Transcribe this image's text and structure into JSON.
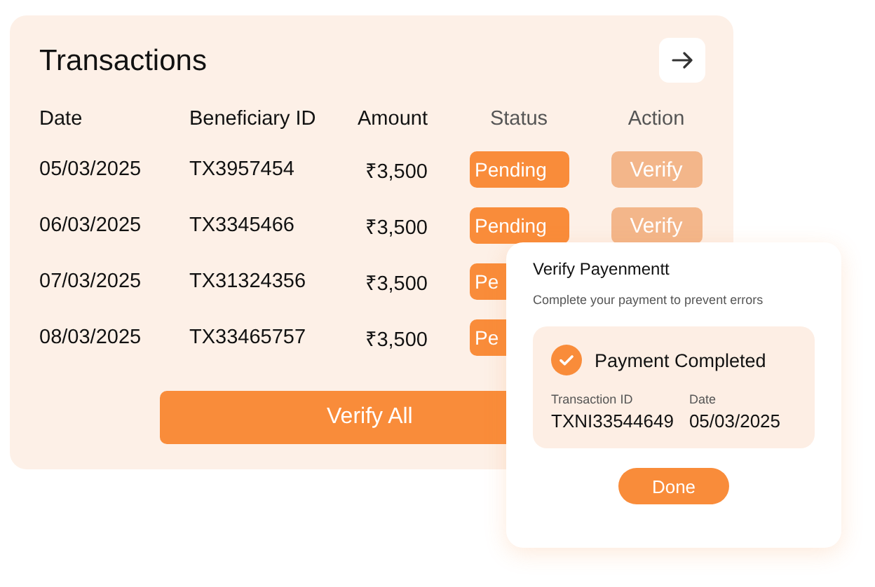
{
  "transactions": {
    "title": "Transactions",
    "columns": [
      "Date",
      "Beneficiary ID",
      "Amount",
      "Status",
      "Action"
    ],
    "rows": [
      {
        "date": "05/03/2025",
        "beneficiary_id": "TX3957454",
        "amount": "₹3,500",
        "status": "Pending",
        "action": "Verify"
      },
      {
        "date": "06/03/2025",
        "beneficiary_id": "TX3345466",
        "amount": "₹3,500",
        "status": "Pending",
        "action": "Verify"
      },
      {
        "date": "07/03/2025",
        "beneficiary_id": "TX31324356",
        "amount": "₹3,500",
        "status": "Pe"
      },
      {
        "date": "08/03/2025",
        "beneficiary_id": "TX33465757",
        "amount": "₹3,500",
        "status": "Pe"
      }
    ],
    "verify_all_button": "Verify All"
  },
  "dialog": {
    "title": "Verify Payenmentt",
    "subtitle": "Complete your payment to prevent errors",
    "result": {
      "title": "Payment Completed",
      "fields": [
        {
          "label": "Transaction ID",
          "value": "TXNI33544649"
        },
        {
          "label": "Date",
          "value": "05/03/2025"
        }
      ]
    },
    "button": "Done"
  }
}
